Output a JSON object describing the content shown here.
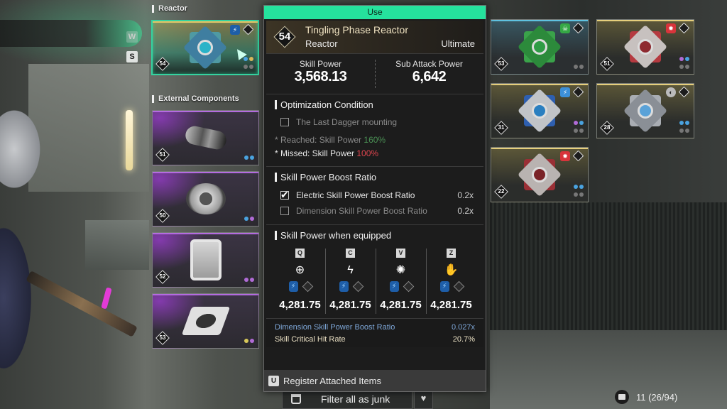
{
  "equipped": {
    "reactor_section_label": "Reactor",
    "external_section_label": "External Components",
    "keys": {
      "up": "W",
      "down": "S"
    },
    "reactor": {
      "level": "54",
      "element": "electric",
      "sockets": [
        "#4aa3e0",
        "#d8b85a"
      ],
      "slots": 2
    },
    "external_components": [
      {
        "level": "51",
        "name": "capsule",
        "sockets": [
          "#4aa3e0",
          "#4aa3e0"
        ]
      },
      {
        "level": "50",
        "name": "ring",
        "sockets": [
          "#4aa3e0",
          "#b06bd6"
        ]
      },
      {
        "level": "52",
        "name": "box",
        "sockets": [
          "#b06bd6",
          "#b06bd6"
        ]
      },
      {
        "level": "53",
        "name": "chip",
        "sockets": [
          "#d8c85a",
          "#b06bd6"
        ]
      }
    ]
  },
  "tooltip": {
    "action_label": "Use",
    "level": "54",
    "name": "Tingling Phase Reactor",
    "type": "Reactor",
    "tier": "Ultimate",
    "skill_power_label": "Skill Power",
    "skill_power_value": "3,568.13",
    "sub_attack_label": "Sub Attack Power",
    "sub_attack_value": "6,642",
    "optimization": {
      "title": "Optimization Condition",
      "condition": "The Last Dagger mounting",
      "condition_checked": false,
      "reached_label": "* Reached: Skill Power ",
      "reached_value": "160%",
      "missed_label": "* Missed: Skill Power ",
      "missed_value": "100%"
    },
    "boost_ratio": {
      "title": "Skill Power Boost Ratio",
      "items": [
        {
          "label": "Electric Skill Power Boost Ratio",
          "value": "0.2x",
          "checked": true
        },
        {
          "label": "Dimension Skill Power Boost Ratio",
          "value": "0.2x",
          "checked": false
        }
      ]
    },
    "equipped_power": {
      "title": "Skill Power when equipped",
      "skills": [
        {
          "key": "Q",
          "icon": "crosshair-icon",
          "value": "4,281.75"
        },
        {
          "key": "C",
          "icon": "lightning-burst-icon",
          "value": "4,281.75"
        },
        {
          "key": "V",
          "icon": "gear-burst-icon",
          "value": "4,281.75"
        },
        {
          "key": "Z",
          "icon": "hand-blade-icon",
          "value": "4,281.75"
        }
      ]
    },
    "extra_stats": [
      {
        "label": "Dimension Skill Power Boost Ratio",
        "value": "0.027x",
        "color": "#7ea7d8"
      },
      {
        "label": "Skill Critical Hit Rate",
        "value": "20.7%",
        "color": "#e9dfc3"
      }
    ],
    "footer": {
      "key": "U",
      "label": "Register Attached Items"
    }
  },
  "inventory": {
    "reactors": [
      {
        "level": "53",
        "element": "toxic",
        "element_color": "#35a845",
        "gem_color": "#3aa34a",
        "sockets": [],
        "frame": "blue"
      },
      {
        "level": "51",
        "element": "fire",
        "element_color": "#d8343b",
        "gem_color": "#b53a40",
        "sockets": [
          "#b06bd6",
          "#4aa3e0"
        ],
        "frame": "gold"
      },
      {
        "level": "31",
        "element": "electric",
        "element_color": "#3c8fd8",
        "gem_color": "#2e5fb0",
        "sockets": [
          "#b06bd6",
          "#4aa3e0"
        ],
        "frame": "gold"
      },
      {
        "level": "28",
        "element": "non-attribute",
        "element_color": "#bbbbbb",
        "gem_color": "#8aa0b8",
        "sockets": [
          "#4aa3e0",
          "#4aa3e0"
        ],
        "frame": "gold"
      },
      {
        "level": "22",
        "element": "fire",
        "element_color": "#d8343b",
        "gem_color": "#9a2f35",
        "sockets": [
          "#4aa3e0",
          "#4aa3e0"
        ],
        "frame": "gold"
      }
    ],
    "filter_label": "Filter all as junk",
    "count_text": "11 (26/94)"
  }
}
